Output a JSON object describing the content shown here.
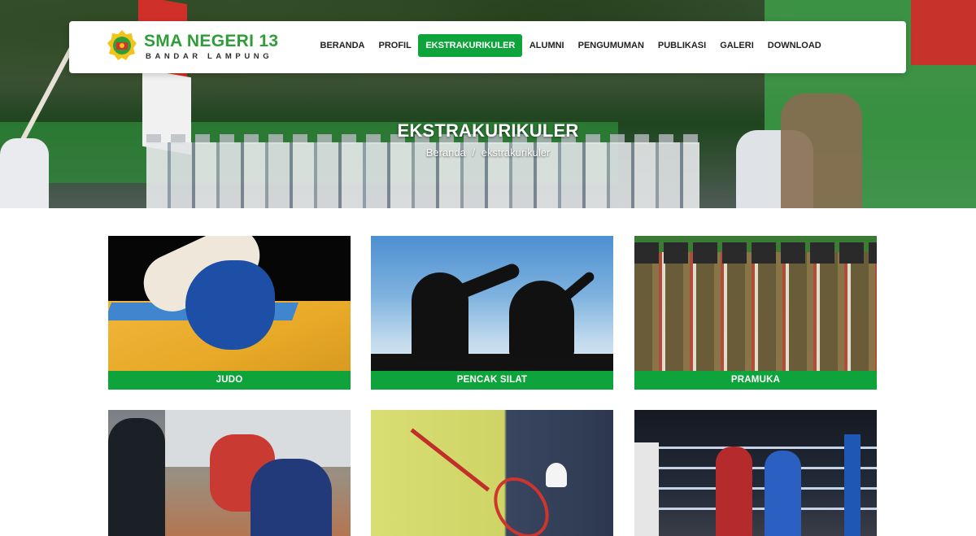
{
  "site": {
    "name": "SMA NEGERI 13",
    "subtitle": "BANDAR LAMPUNG",
    "brand_color": "#0fa33b"
  },
  "nav": {
    "items": [
      {
        "label": "BERANDA",
        "active": false
      },
      {
        "label": "PROFIL",
        "active": false
      },
      {
        "label": "EKSTRAKURIKULER",
        "active": true
      },
      {
        "label": "ALUMNI",
        "active": false
      },
      {
        "label": "PENGUMUMAN",
        "active": false
      },
      {
        "label": "PUBLIKASI",
        "active": false
      },
      {
        "label": "GALERI",
        "active": false
      },
      {
        "label": "DOWNLOAD",
        "active": false
      }
    ]
  },
  "hero": {
    "title": "EKSTRAKURIKULER",
    "breadcrumb": {
      "home": "Beranda",
      "separator": "/",
      "current": "ekstrakurikuler"
    }
  },
  "activities": [
    {
      "label": "JUDO",
      "image": "judo-photo"
    },
    {
      "label": "PENCAK SILAT",
      "image": "pencak-silat-photo"
    },
    {
      "label": "PRAMUKA",
      "image": "pramuka-photo"
    },
    {
      "label": "",
      "image": "pmr-photo"
    },
    {
      "label": "",
      "image": "badminton-photo"
    },
    {
      "label": "",
      "image": "boxing-photo"
    }
  ]
}
